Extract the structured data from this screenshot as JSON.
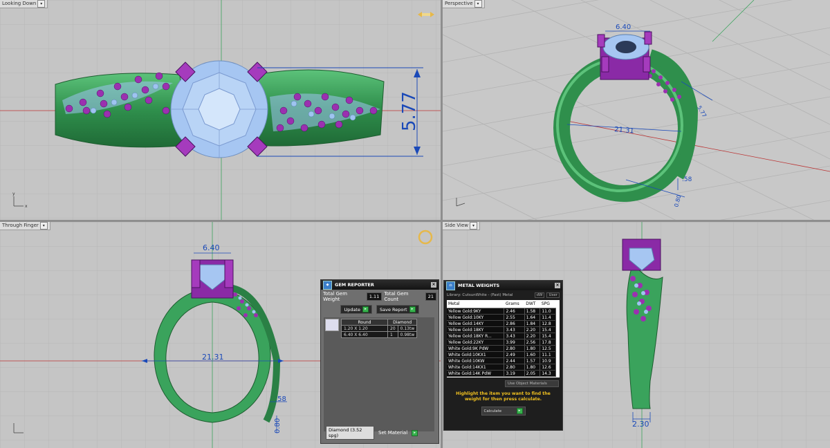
{
  "viewports": {
    "top": {
      "title": "Looking Down",
      "dim_height": "5.77"
    },
    "perspective": {
      "title": "Perspective",
      "dim_width": "6.40",
      "dim_diameter": "21.31",
      "dim_side": "5.77",
      "dim_band": ".58",
      "dim_thick": "0.80"
    },
    "front": {
      "title": "Through Finger",
      "dim_width": "6.40",
      "dim_diameter": "21.31",
      "dim_band": ".58",
      "dim_thick": "0.80"
    },
    "side": {
      "title": "Side View",
      "dim_width": "2.30"
    }
  },
  "gem_reporter": {
    "title": "GEM REPORTER",
    "total_weight_label": "Total Gem Weight",
    "total_weight_value": "1.11",
    "total_count_label": "Total Gem Count",
    "total_count_value": "21",
    "update_label": "Update",
    "save_report_label": "Save Report",
    "table_headers": [
      "Round",
      "Diamond"
    ],
    "rows": [
      {
        "size": "1.20 X 1.20",
        "count": "20",
        "weight": "0.13tw"
      },
      {
        "size": "6.40 X 6.40",
        "count": "1",
        "weight": "0.98tw"
      }
    ],
    "material_select": "Diamond     (3.52 spg)",
    "set_material_label": "Set Material"
  },
  "metal_weights": {
    "title": "METAL WEIGHTS",
    "library_label": "Library: CutsunWhite - (Fast) Metal",
    "dw_label": "dW",
    "user_label": "User",
    "headers": [
      "Metal",
      "Grams",
      "DWT",
      "SPG"
    ],
    "rows": [
      [
        "Yellow Gold:9KY",
        "2.46",
        "1.58",
        "11.0"
      ],
      [
        "Yellow Gold:10KY",
        "2.55",
        "1.64",
        "11.4"
      ],
      [
        "Yellow Gold:14KY",
        "2.86",
        "1.84",
        "12.8"
      ],
      [
        "Yellow Gold:18KY",
        "3.43",
        "2.20",
        "15.4"
      ],
      [
        "Yellow Gold:18KY R...",
        "3.43",
        "2.20",
        "15.4"
      ],
      [
        "Yellow Gold:22KY",
        "3.99",
        "2.56",
        "17.8"
      ],
      [
        "White Gold:9K PdW",
        "2.80",
        "1.80",
        "12.5"
      ],
      [
        "White Gold:10KX1",
        "2.49",
        "1.60",
        "11.1"
      ],
      [
        "White Gold:10KW",
        "2.44",
        "1.57",
        "10.9"
      ],
      [
        "White Gold:14KX1",
        "2.80",
        "1.80",
        "12.6"
      ],
      [
        "White Gold:14K PdW",
        "3.19",
        "2.05",
        "14.3"
      ]
    ],
    "use_object_label": "Use Object Materials",
    "hint": "Highlight the item you want to find the weight for then press calculate.",
    "calculate_label": "Calculate"
  },
  "colors": {
    "metal": "#3aa35c",
    "prong": "#9b30b0",
    "gem": "#9ec4f0",
    "dimension": "#1a49b8"
  }
}
